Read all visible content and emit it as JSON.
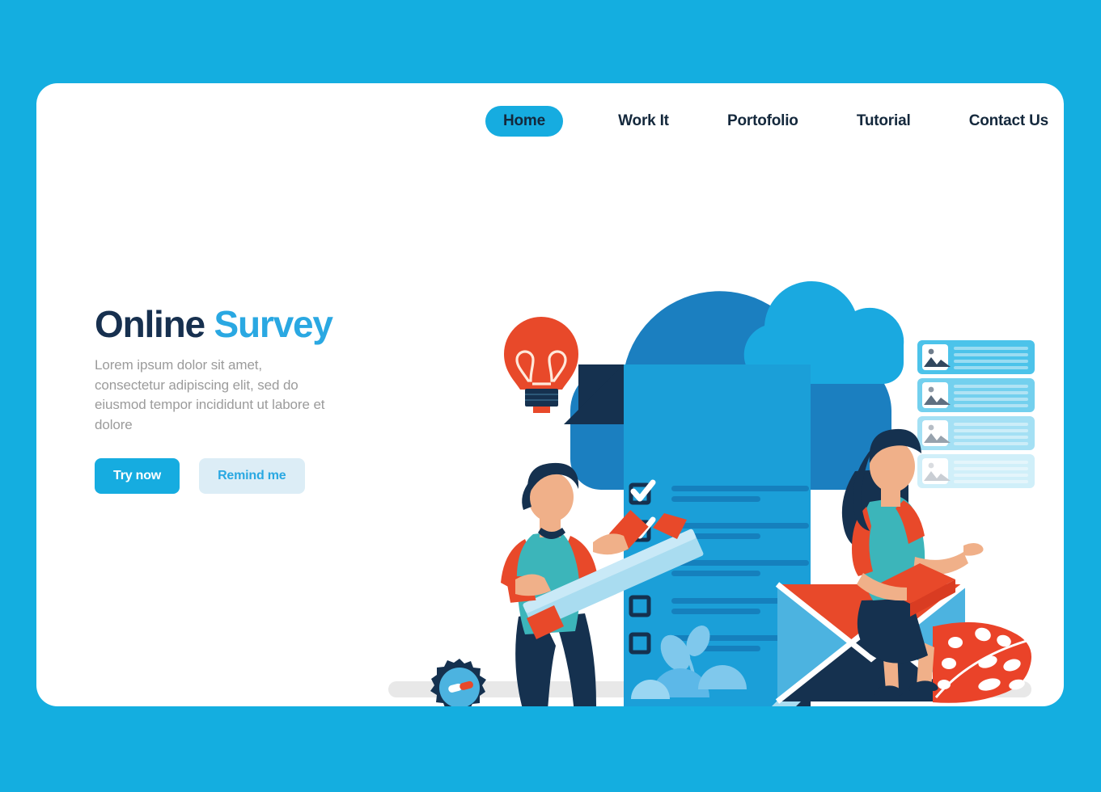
{
  "page": {
    "background_color": "#14aee0",
    "card_color": "#ffffff"
  },
  "nav": {
    "items": [
      {
        "label": "Home",
        "active": true
      },
      {
        "label": "Work It",
        "active": false
      },
      {
        "label": "Portofolio",
        "active": false
      },
      {
        "label": "Tutorial",
        "active": false
      },
      {
        "label": "Contact Us",
        "active": false
      }
    ]
  },
  "hero": {
    "title_part1": "Online",
    "title_part2": "Survey",
    "paragraph": "Lorem ipsum dolor sit amet, consectetur adipiscing elit, sed do eiusmod tempor incididunt ut labore et dolore",
    "primary_button": "Try now",
    "secondary_button": "Remind me",
    "colors": {
      "title_dark": "#17304f",
      "title_accent": "#2aa8e2",
      "paragraph": "#9b9b9b",
      "primary_bg": "#16ace0",
      "primary_text": "#ffffff",
      "secondary_bg": "#dcedf6",
      "secondary_text": "#2aa8e2"
    }
  },
  "illustration": {
    "name": "online-survey-illustration",
    "elements": [
      "cloud-large",
      "cloud-small",
      "survey-document",
      "checklist",
      "lightbulb",
      "gear-large",
      "gear-small",
      "man-with-pencil",
      "woman-with-tablet",
      "envelope",
      "monstera-leaf",
      "media-card-list",
      "ground-bar",
      "foliage"
    ],
    "checklist": {
      "rows": [
        {
          "checked": true
        },
        {
          "checked": true
        },
        {
          "checked": true
        },
        {
          "checked": false
        },
        {
          "checked": false
        }
      ]
    },
    "media_cards": [
      {
        "opacity": 1.0
      },
      {
        "opacity": 0.78
      },
      {
        "opacity": 0.5
      },
      {
        "opacity": 0.26
      }
    ],
    "colors": {
      "cloud_dark": "#1b7fc0",
      "cloud_light": "#1aa9e0",
      "document": "#1b9fd8",
      "document_line": "#1580bd",
      "document_fold": "#15314f",
      "navy": "#15314f",
      "teal": "#3cb5ba",
      "orange": "#e8492a",
      "skin": "#f0b089",
      "pencil": "#a9dcf0",
      "ground": "#e8e8e8",
      "card_blue": "#4cc3ea",
      "leaf_red": "#ea4329"
    }
  }
}
